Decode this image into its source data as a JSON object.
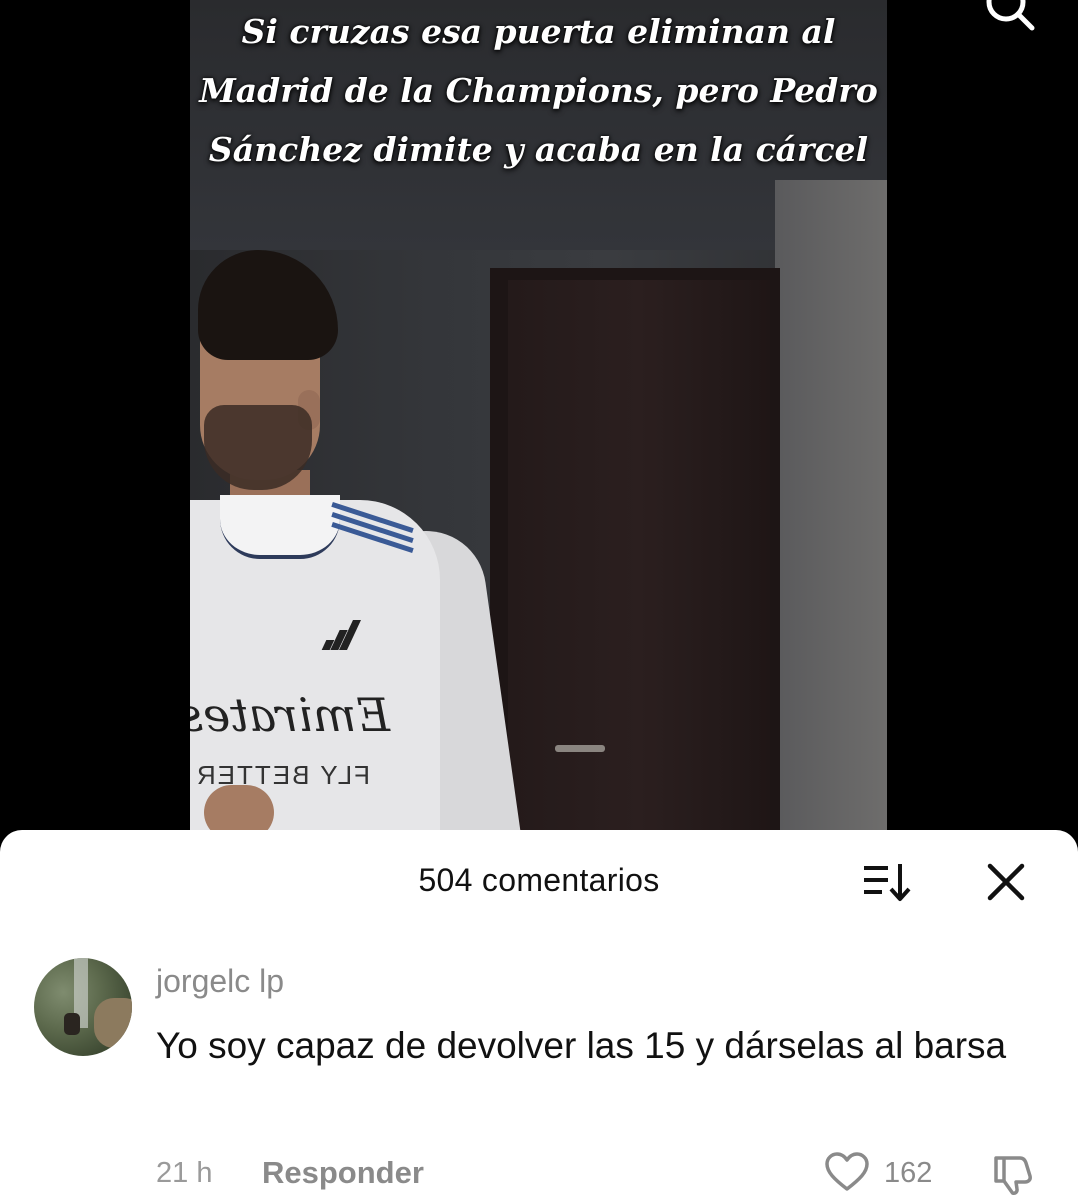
{
  "video": {
    "caption": "Si cruzas esa puerta eliminan al Madrid de la Champions, pero Pedro Sánchez dimite y acaba en la cárcel",
    "jersey_sponsor": "Emirates",
    "jersey_sponsor_sub": "FLY BETTER"
  },
  "comments_sheet": {
    "title": "504 comentarios",
    "sort_icon": "sort-icon",
    "close_icon": "close-icon"
  },
  "comment": {
    "username": "jorgelc lp",
    "text": "Yo soy capaz de devolver las 15 y dárselas al barsa",
    "time": "21 h",
    "reply_label": "Responder",
    "likes": "162",
    "like_icon": "heart-icon",
    "dislike_icon": "dislike-icon"
  },
  "colors": {
    "sheet_background": "#ffffff",
    "secondary_text": "#8a8a8a",
    "primary_text": "#111111"
  }
}
